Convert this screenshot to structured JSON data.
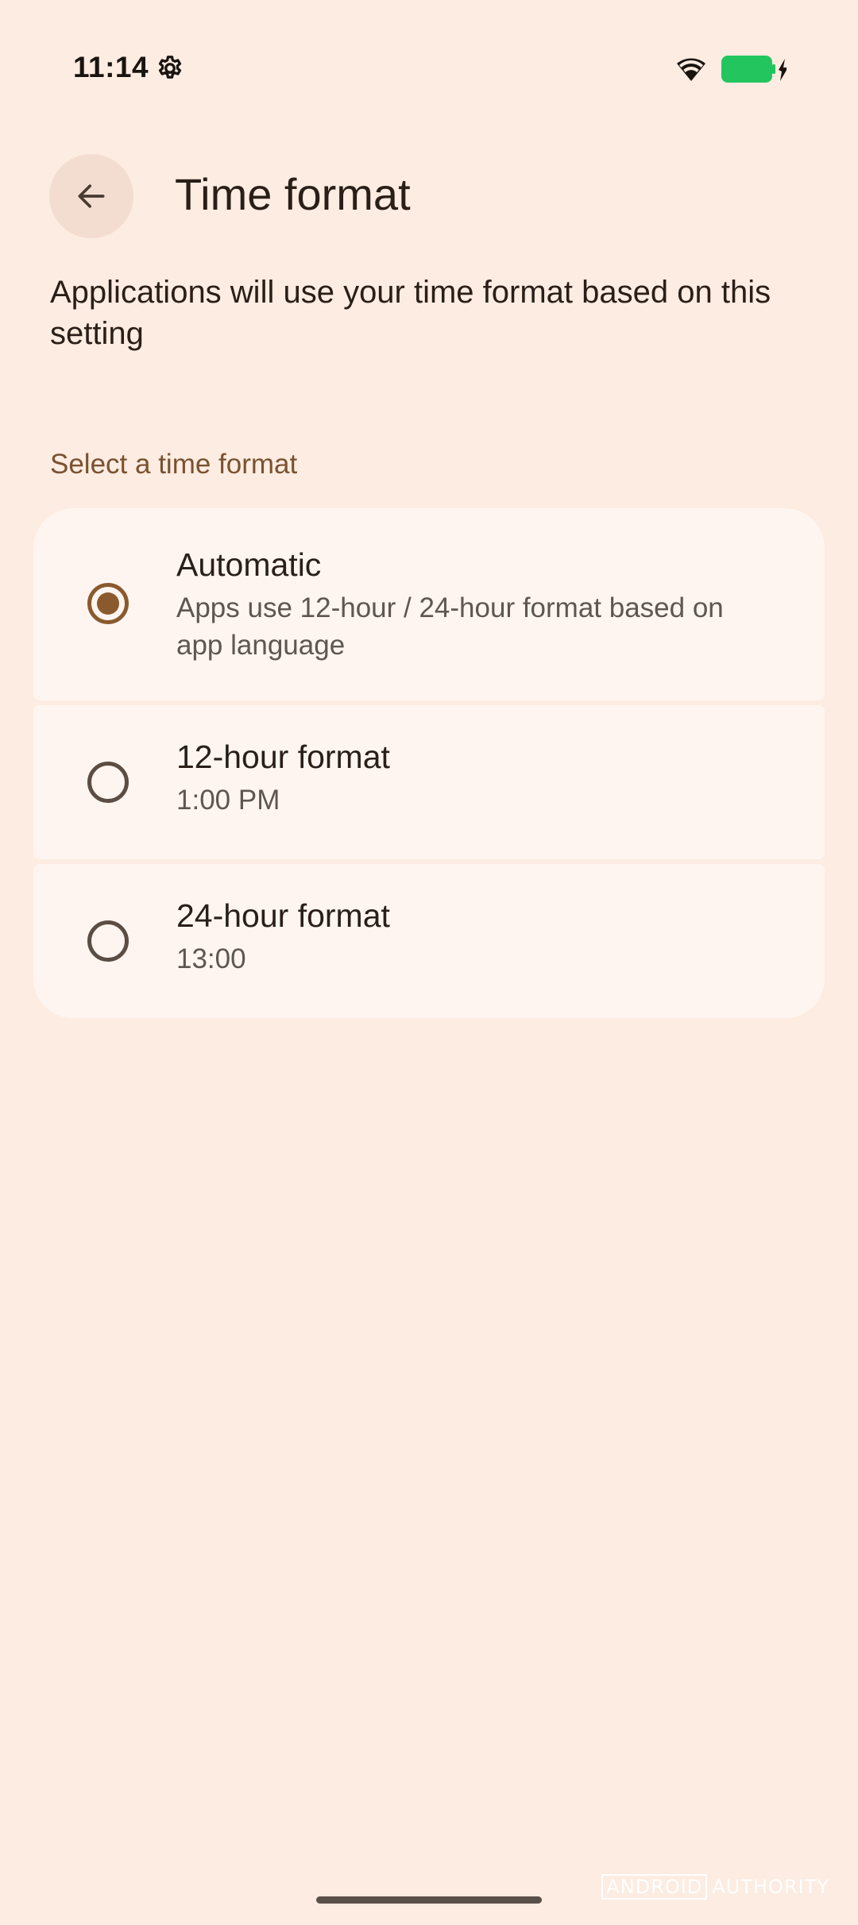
{
  "status_bar": {
    "time": "11:14",
    "settings_icon": "gear-icon",
    "wifi_icon": "wifi-icon",
    "battery_icon": "battery-charging-icon",
    "battery_color": "#22c55e"
  },
  "app_bar": {
    "back_icon": "arrow-back-icon",
    "title": "Time format"
  },
  "description": "Applications will use your time format based on this setting",
  "section_header": "Select a time format",
  "options": [
    {
      "title": "Automatic",
      "subtitle": "Apps use 12-hour / 24-hour format based on app language",
      "selected": true
    },
    {
      "title": "12-hour format",
      "subtitle": "1:00 PM",
      "selected": false
    },
    {
      "title": "24-hour format",
      "subtitle": "13:00",
      "selected": false
    }
  ],
  "watermark": {
    "part1": "ANDROID",
    "part2": "AUTHORITY"
  },
  "colors": {
    "background": "#fdece1",
    "accent": "#8a5a2e",
    "card": "#fff5f0"
  }
}
